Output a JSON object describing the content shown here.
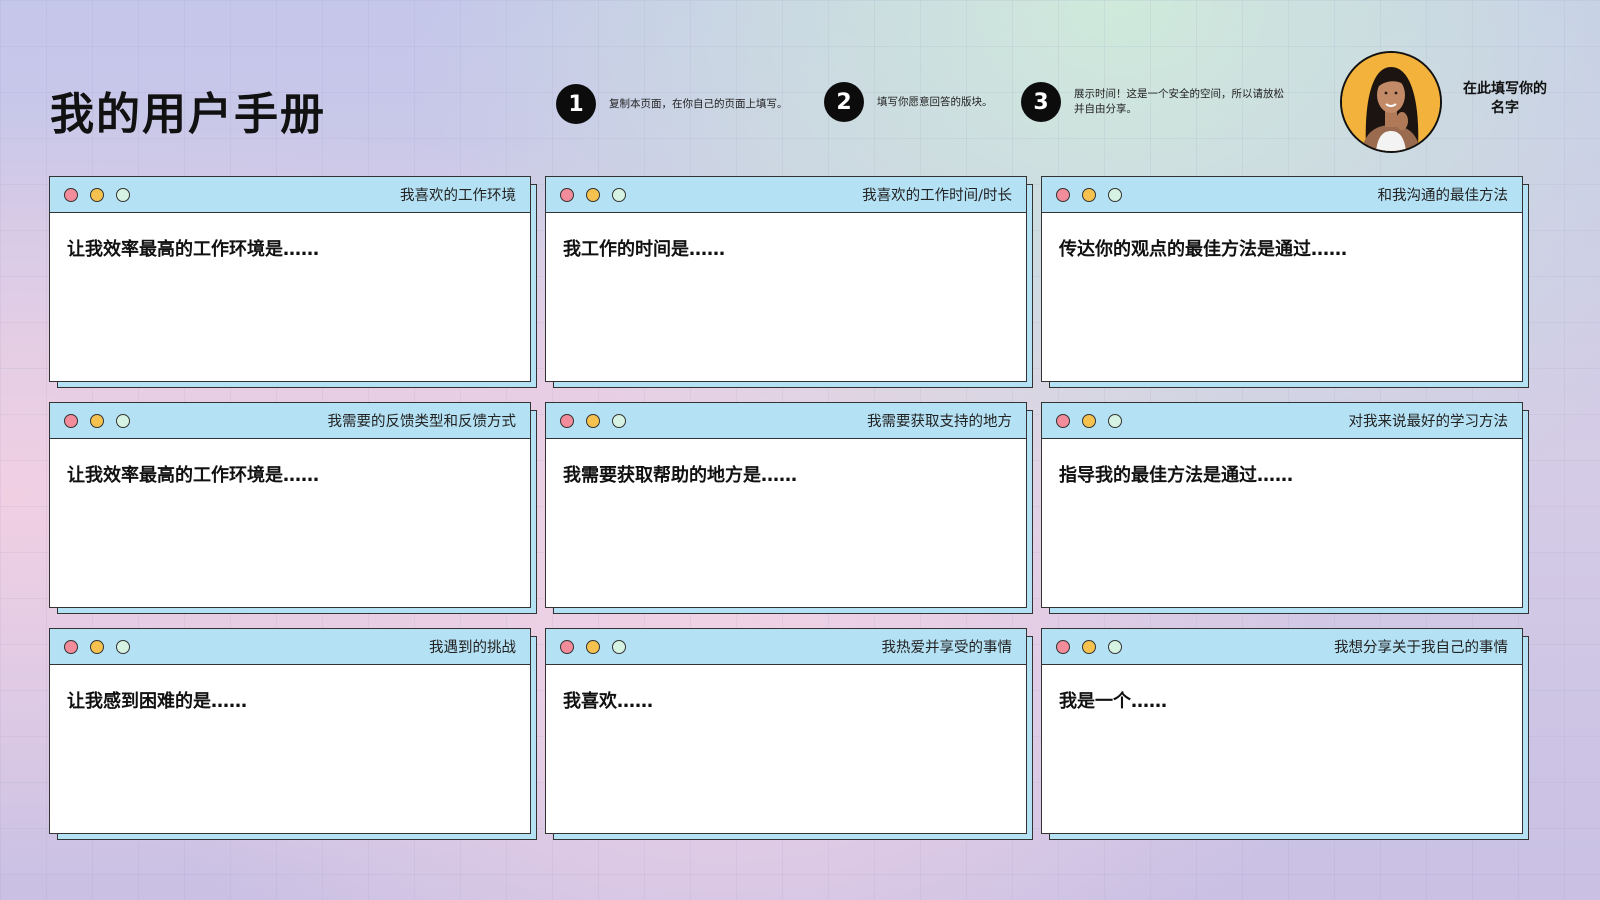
{
  "page": {
    "title": "我的用户手册",
    "name_placeholder": "在此填写你的名字"
  },
  "steps": [
    {
      "number": "1",
      "text": "复制本页面，在你自己的页面上填写。"
    },
    {
      "number": "2",
      "text": "填写你愿意回答的版块。"
    },
    {
      "number": "3",
      "text": "展示时间！这是一个安全的空间，所以请放松并自由分享。"
    }
  ],
  "cards": [
    {
      "title": "我喜欢的工作环境",
      "prompt": "让我效率最高的工作环境是……"
    },
    {
      "title": "我喜欢的工作时间/时长",
      "prompt": "我工作的时间是……"
    },
    {
      "title": "和我沟通的最佳方法",
      "prompt": "传达你的观点的最佳方法是通过……"
    },
    {
      "title": "我需要的反馈类型和反馈方式",
      "prompt": "让我效率最高的工作环境是……"
    },
    {
      "title": "我需要获取支持的地方",
      "prompt": "我需要获取帮助的地方是……"
    },
    {
      "title": "对我来说最好的学习方法",
      "prompt": "指导我的最佳方法是通过……"
    },
    {
      "title": "我遇到的挑战",
      "prompt": "让我感到困难的是……"
    },
    {
      "title": "我热爱并享受的事情",
      "prompt": "我喜欢……"
    },
    {
      "title": "我想分享关于我自己的事情",
      "prompt": "我是一个……"
    }
  ],
  "colors": {
    "card_header": "#b5e1f4",
    "dot_red": "#f28b9a",
    "dot_yellow": "#f5c24f",
    "dot_green": "#d6f3e2",
    "avatar_bg": "#f2b23b"
  }
}
